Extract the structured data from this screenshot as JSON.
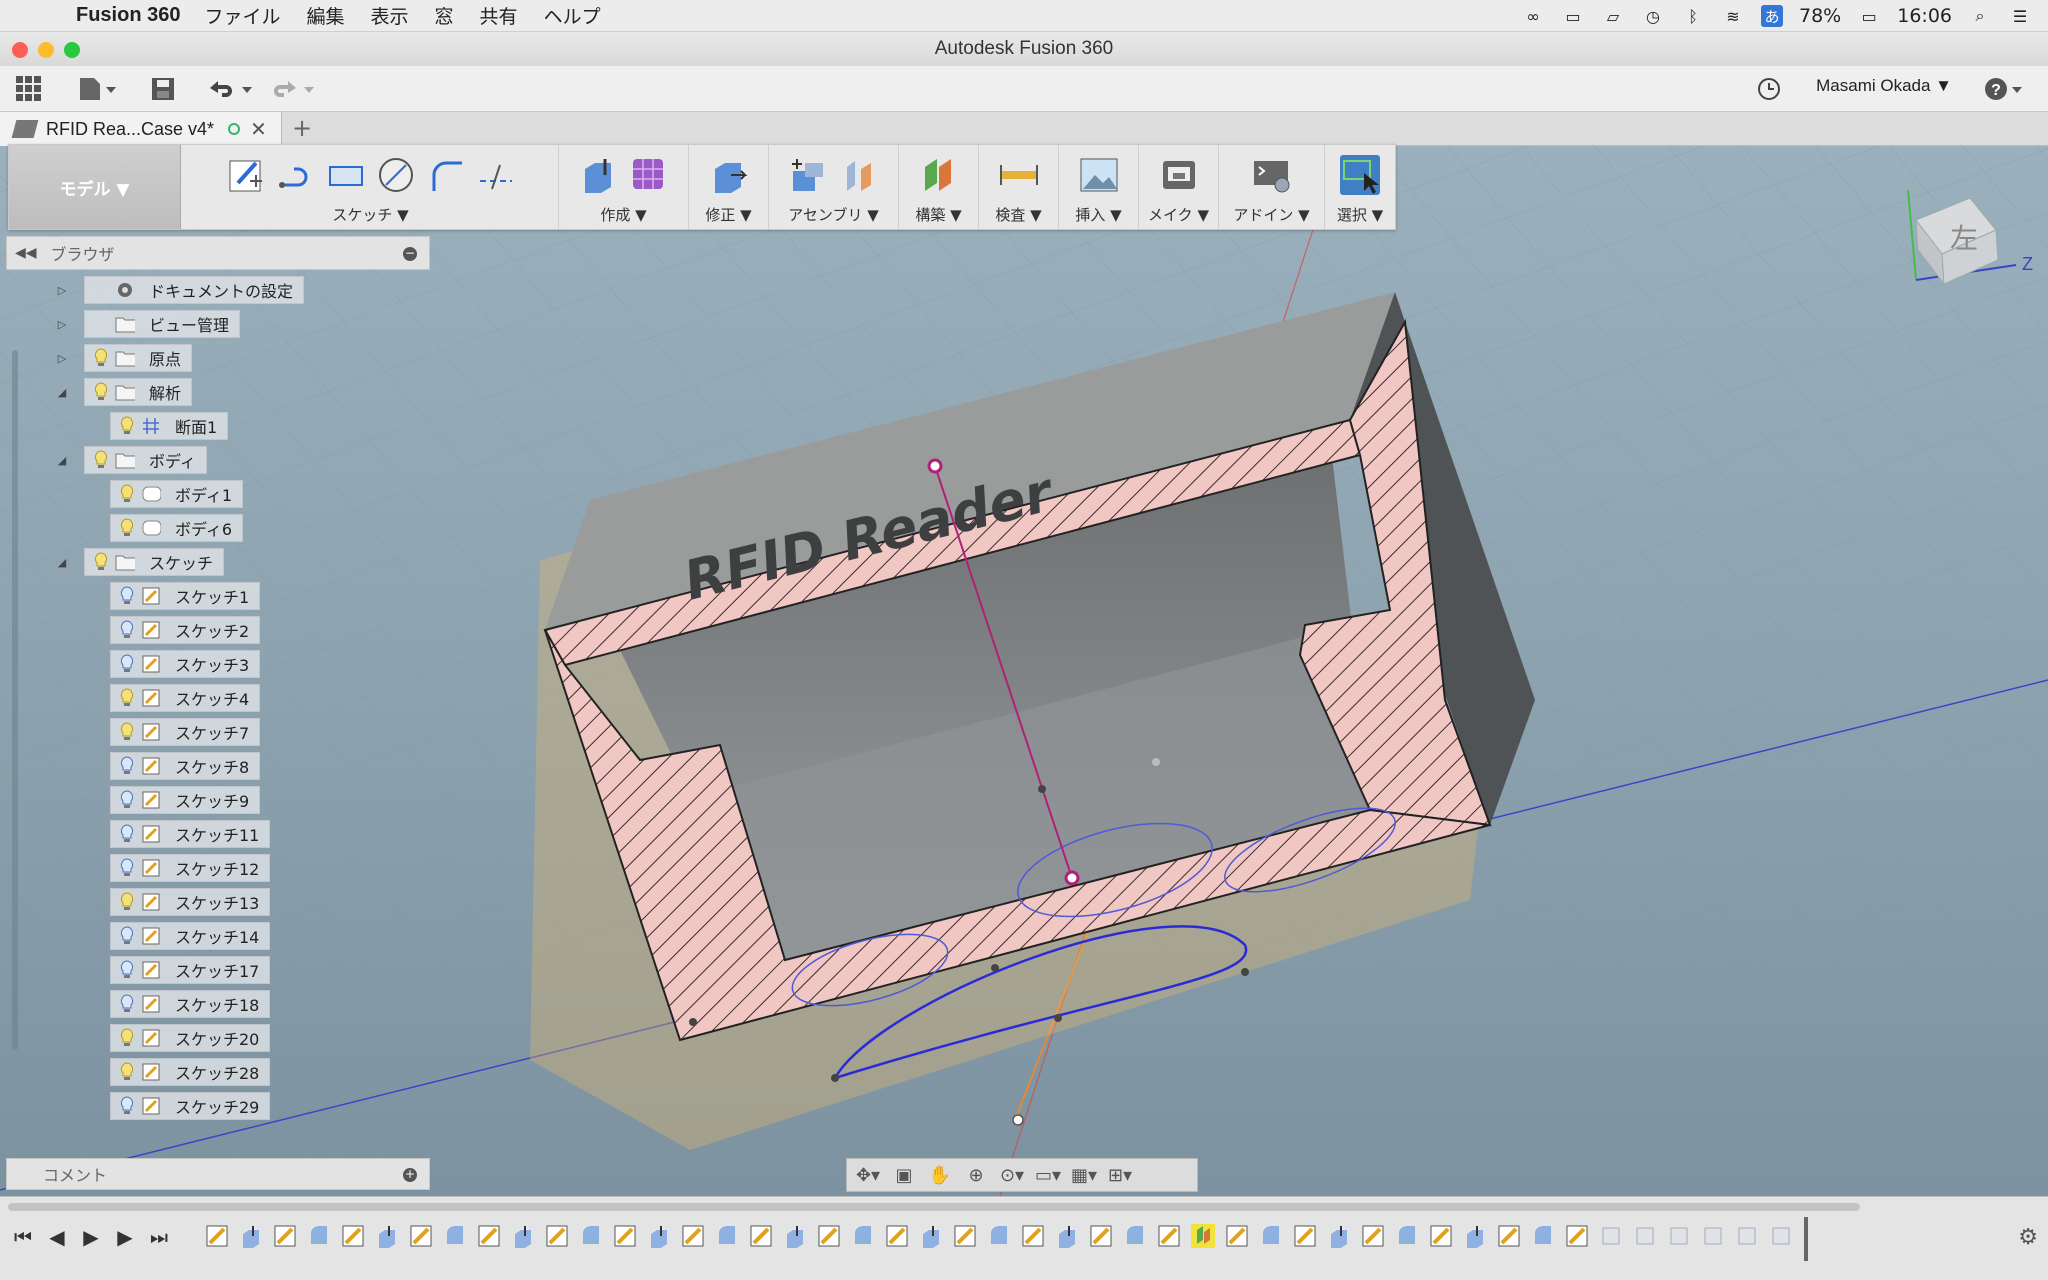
{
  "menubar": {
    "app_name": "Fusion 360",
    "items": [
      "ファイル",
      "編集",
      "表示",
      "窓",
      "共有",
      "ヘルプ"
    ],
    "ime": "あ",
    "battery": "78%",
    "clock": "16:06"
  },
  "window": {
    "title": "Autodesk Fusion 360"
  },
  "app_toolbar": {
    "user": "Masami Okada ▼"
  },
  "tabs": [
    {
      "label": "RFID Rea...Case v4*"
    }
  ],
  "ribbon": {
    "workspace": "モデル ▼",
    "groups": [
      {
        "label": "スケッチ ▼"
      },
      {
        "label": "作成 ▼"
      },
      {
        "label": "修正 ▼"
      },
      {
        "label": "アセンブリ ▼"
      },
      {
        "label": "構築 ▼"
      },
      {
        "label": "検査 ▼"
      },
      {
        "label": "挿入 ▼"
      },
      {
        "label": "メイク ▼"
      },
      {
        "label": "アドイン ▼"
      },
      {
        "label": "選択 ▼"
      }
    ]
  },
  "browser": {
    "title": "ブラウザ",
    "nodes": [
      {
        "label": "ドキュメントの設定",
        "icon": "gear-icon"
      },
      {
        "label": "ビュー管理",
        "icon": "folder-icon"
      },
      {
        "label": "原点",
        "icon": "folder-icon"
      },
      {
        "label": "解析",
        "icon": "folder-icon"
      },
      {
        "label": "断面1",
        "icon": "section-icon"
      },
      {
        "label": "ボディ",
        "icon": "folder-icon"
      },
      {
        "label": "ボディ1",
        "icon": "body-icon"
      },
      {
        "label": "ボディ6",
        "icon": "body-icon"
      },
      {
        "label": "スケッチ",
        "icon": "folder-icon"
      },
      {
        "label": "スケッチ1",
        "icon": "sketch-icon"
      },
      {
        "label": "スケッチ2",
        "icon": "sketch-icon"
      },
      {
        "label": "スケッチ3",
        "icon": "sketch-icon"
      },
      {
        "label": "スケッチ4",
        "icon": "sketch-icon"
      },
      {
        "label": "スケッチ7",
        "icon": "sketch-icon"
      },
      {
        "label": "スケッチ8",
        "icon": "sketch-icon"
      },
      {
        "label": "スケッチ9",
        "icon": "sketch-icon"
      },
      {
        "label": "スケッチ11",
        "icon": "sketch-icon"
      },
      {
        "label": "スケッチ12",
        "icon": "sketch-icon"
      },
      {
        "label": "スケッチ13",
        "icon": "sketch-icon"
      },
      {
        "label": "スケッチ14",
        "icon": "sketch-icon"
      },
      {
        "label": "スケッチ17",
        "icon": "sketch-icon"
      },
      {
        "label": "スケッチ18",
        "icon": "sketch-icon"
      },
      {
        "label": "スケッチ20",
        "icon": "sketch-icon"
      },
      {
        "label": "スケッチ28",
        "icon": "sketch-icon"
      },
      {
        "label": "スケッチ29",
        "icon": "sketch-icon"
      }
    ]
  },
  "comments": {
    "title": "コメント"
  },
  "viewcube": {
    "face": "左",
    "axis_z": "Z"
  },
  "model": {
    "embossed_text": "RFID Reader"
  },
  "colors": {
    "section_fill": "#f1c7c4",
    "sketch_line": "#2b2bd6",
    "axis_orange": "#e08a3a",
    "selection_magenta": "#b0207a",
    "viewport_bg": "#8fa3ae",
    "active_blue": "#3f7fc4"
  }
}
